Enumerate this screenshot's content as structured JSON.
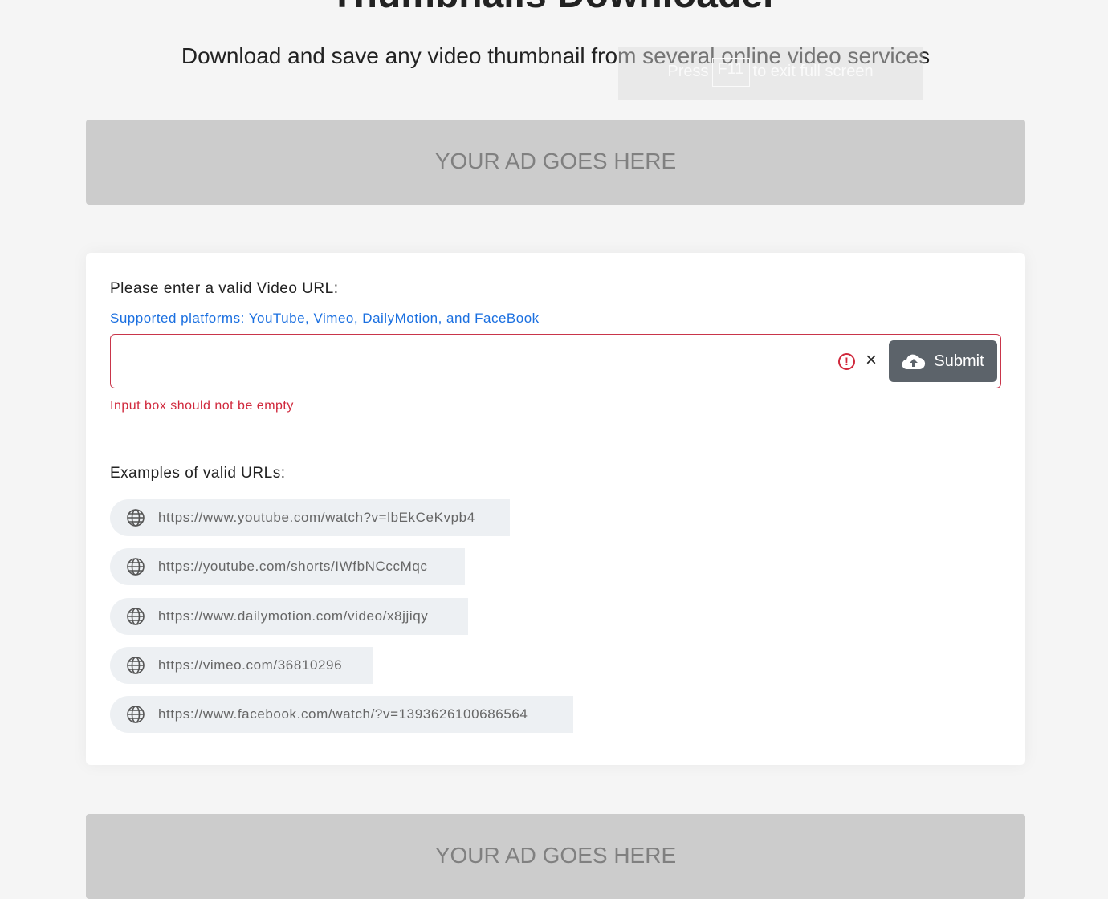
{
  "header": {
    "title": "Thumbnails Downloader",
    "subtitle": "Download and save any video thumbnail from several online video services"
  },
  "fullscreen_notice": {
    "before": "Press",
    "key": "F11",
    "after": "to exit full screen"
  },
  "ads": {
    "top": "YOUR AD GOES HERE",
    "bottom": "YOUR AD GOES HERE"
  },
  "form": {
    "label": "Please enter a valid Video URL:",
    "platforms": "Supported platforms: YouTube, Vimeo, DailyMotion, and FaceBook",
    "value": "",
    "clear": "×",
    "submit": "Submit",
    "error": "Input box should not be empty",
    "error_color": "#d0283c"
  },
  "examples": {
    "label": "Examples of valid URLs:",
    "items": [
      "https://www.youtube.com/watch?v=lbEkCeKvpb4",
      "https://youtube.com/shorts/IWfbNCccMqc",
      "https://www.dailymotion.com/video/x8jjiqy",
      "https://vimeo.com/36810296",
      "https://www.facebook.com/watch/?v=1393626100686564"
    ]
  }
}
